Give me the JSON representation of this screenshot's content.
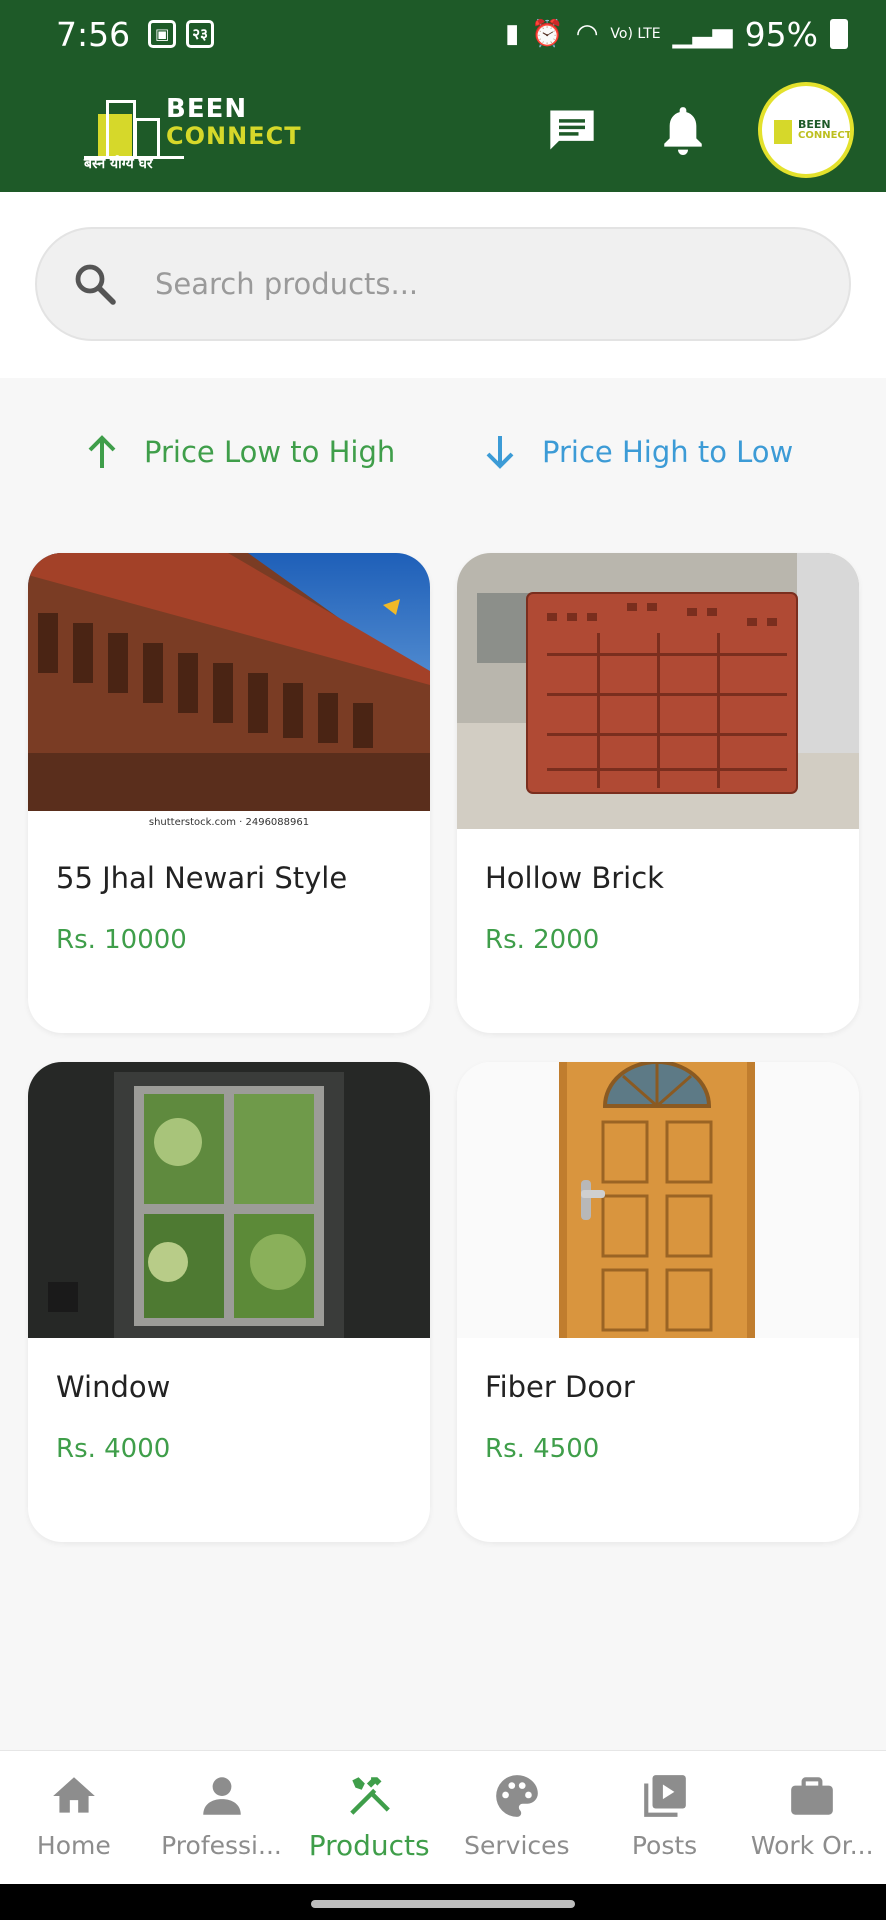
{
  "status_bar": {
    "time": "7:56",
    "left_icons": [
      "image-notification-icon",
      "ime-icon"
    ],
    "ime_label": "२३",
    "network_label": "Vo) LTE",
    "battery": "95%"
  },
  "header": {
    "logo_line1": "BEEN",
    "logo_line2": "CONNECT",
    "logo_tagline": "बस्न योग्य घर",
    "icons": [
      "chat-icon",
      "bell-icon",
      "profile-avatar"
    ]
  },
  "search": {
    "placeholder": "Search products..."
  },
  "sort": {
    "low_to_high": "Price Low to High",
    "high_to_low": "Price High to Low"
  },
  "products": [
    {
      "title": "55 Jhal Newari Style",
      "price": "Rs. 10000",
      "image_caption": "shutterstock.com · 2496088961"
    },
    {
      "title": "Hollow Brick",
      "price": "Rs. 2000"
    },
    {
      "title": "Window",
      "price": "Rs. 4000"
    },
    {
      "title": "Fiber Door",
      "price": "Rs. 4500"
    }
  ],
  "bottom_nav": [
    {
      "label": "Home",
      "icon": "home-icon",
      "active": false
    },
    {
      "label": "Professi...",
      "icon": "person-icon",
      "active": false
    },
    {
      "label": "Products",
      "icon": "tools-icon",
      "active": true
    },
    {
      "label": "Services",
      "icon": "palette-icon",
      "active": false
    },
    {
      "label": "Posts",
      "icon": "video-library-icon",
      "active": false
    },
    {
      "label": "Work Or...",
      "icon": "briefcase-icon",
      "active": false
    }
  ],
  "colors": {
    "brand_green": "#1e5a28",
    "accent_yellow": "#d6d82a",
    "price_green": "#3f9e4a",
    "sort_blue": "#3c9bd6"
  }
}
